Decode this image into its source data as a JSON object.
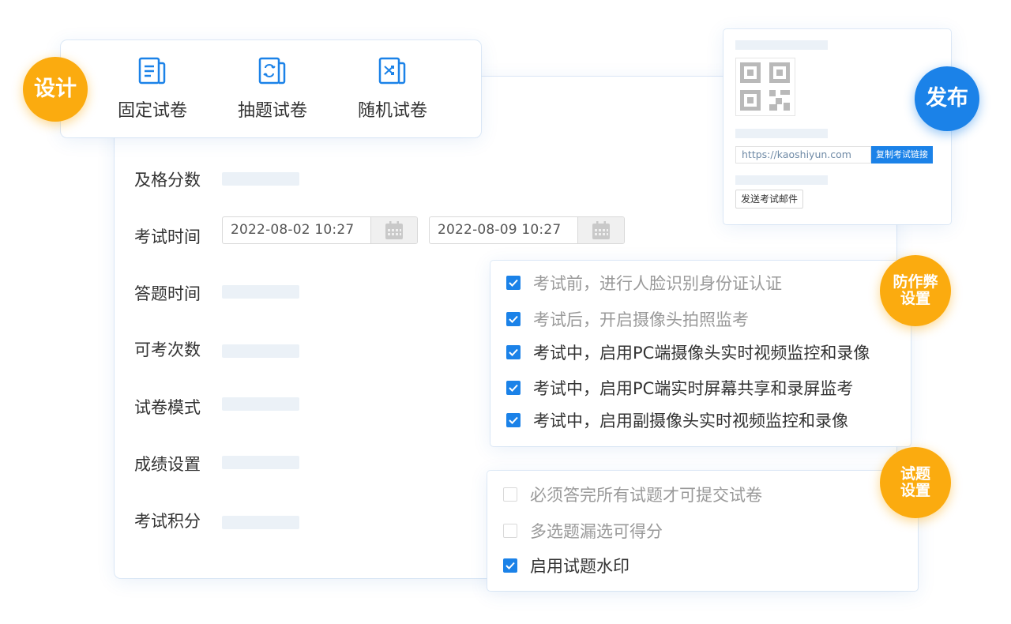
{
  "badges": {
    "design": "设计",
    "publish": "发布",
    "anti_cheat": "防作弊\n设置",
    "question": "试题\n设置"
  },
  "design": {
    "items": [
      {
        "label": "固定试卷",
        "icon": "fixed-paper-icon"
      },
      {
        "label": "抽题试卷",
        "icon": "draw-questions-paper-icon"
      },
      {
        "label": "随机试卷",
        "icon": "random-paper-icon"
      }
    ]
  },
  "form": {
    "rows": [
      {
        "label": "及格分数"
      },
      {
        "label": "考试时间"
      },
      {
        "label": "答题时间"
      },
      {
        "label": "可考次数"
      },
      {
        "label": "试卷模式"
      },
      {
        "label": "成绩设置"
      },
      {
        "label": "考试积分"
      }
    ],
    "start_time": "2022-08-02 10:27",
    "end_time": "2022-08-09 10:27"
  },
  "publish": {
    "url": "https://kaoshiyun.com",
    "copy_button": "复制考试链接",
    "mail_button": "发送考试邮件"
  },
  "anti_cheat": {
    "options": [
      {
        "label": "考试前，进行人脸识别身份证认证",
        "checked": true,
        "muted": true
      },
      {
        "label": "考试后，开启摄像头拍照监考",
        "checked": true,
        "muted": true
      },
      {
        "label": "考试中，启用PC端摄像头实时视频监控和录像",
        "checked": true,
        "muted": false
      },
      {
        "label": "考试中，启用PC端实时屏幕共享和录屏监考",
        "checked": true,
        "muted": false
      },
      {
        "label": "考试中，启用副摄像头实时视频监控和录像",
        "checked": true,
        "muted": false
      }
    ]
  },
  "question_settings": {
    "options": [
      {
        "label": "必须答完所有试题才可提交试卷",
        "checked": false
      },
      {
        "label": "多选题漏选可得分",
        "checked": false
      },
      {
        "label": "启用试题水印",
        "checked": true
      }
    ]
  },
  "colors": {
    "accent_blue": "#1b82e8",
    "badge_orange": "#fbab0f",
    "placeholder": "#ebf1f7"
  }
}
